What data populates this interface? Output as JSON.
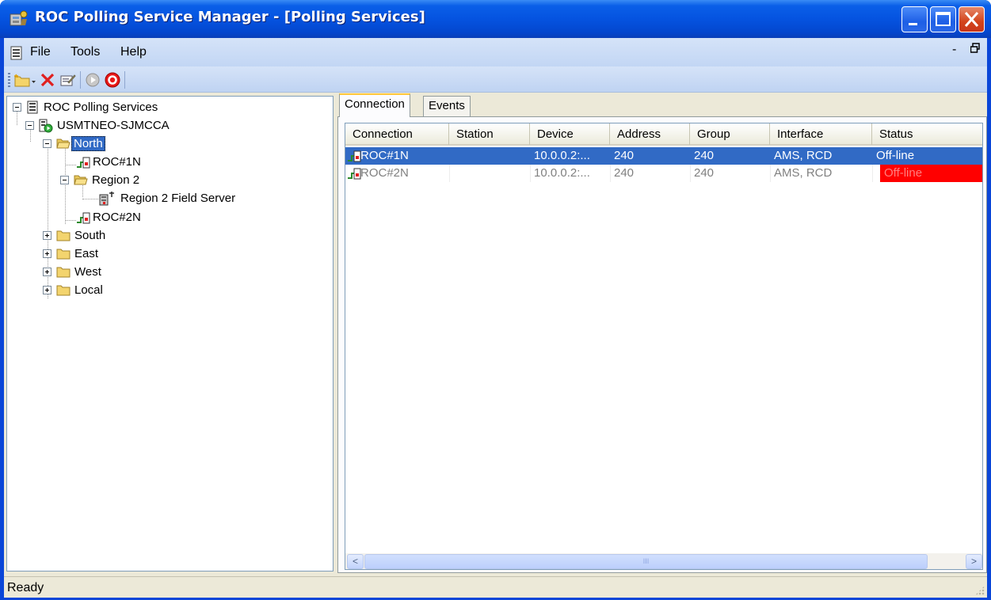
{
  "window": {
    "title": "ROC Polling Service Manager - [Polling Services]"
  },
  "menu": {
    "file": "File",
    "tools": "Tools",
    "help": "Help",
    "mdi_minimize": "-",
    "mdi_restore": "Ɖ"
  },
  "tree": {
    "root": "ROC Polling Services",
    "server": "USMTNEO-SJMCCA",
    "north": "North",
    "roc1n": "ROC#1N",
    "region2": "Region 2",
    "region2_field_server": "Region 2 Field Server",
    "roc2n": "ROC#2N",
    "south": "South",
    "east": "East",
    "west": "West",
    "local": "Local"
  },
  "tabs": {
    "connection": "Connection",
    "events": "Events"
  },
  "table": {
    "columns": [
      "Connection",
      "Station",
      "Device",
      "Address",
      "Group",
      "Interface",
      "Status"
    ],
    "rows": [
      {
        "connection": "ROC#1N",
        "station": "",
        "device": "10.0.0.2:...",
        "address": "240",
        "group": "240",
        "interface": "AMS, RCD",
        "status": "Off-line"
      },
      {
        "connection": "ROC#2N",
        "station": "",
        "device": "10.0.0.2:...",
        "address": "240",
        "group": "240",
        "interface": "AMS, RCD",
        "status": "Off-line"
      }
    ]
  },
  "scrollbar": {
    "left": "<",
    "right": ">",
    "thumb": "III"
  },
  "status": {
    "text": "Ready"
  },
  "colors": {
    "title_blue": "#0553E0",
    "selection": "#316AC5",
    "offline_red": "#FF0000"
  }
}
